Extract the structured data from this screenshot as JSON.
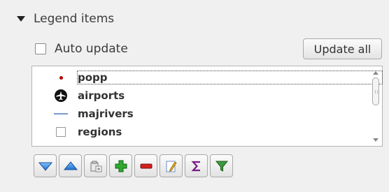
{
  "section": {
    "title": "Legend items",
    "icon": "triangle-down-icon"
  },
  "auto_update": {
    "label": "Auto update",
    "checked": false
  },
  "update_all_label": "Update all",
  "legend_items": [
    {
      "label": "popp",
      "icon": "point-symbol-icon",
      "selected": true
    },
    {
      "label": "airports",
      "icon": "airport-symbol-icon",
      "selected": false
    },
    {
      "label": "majrivers",
      "icon": "line-symbol-icon",
      "selected": false
    },
    {
      "label": "regions",
      "icon": "polygon-symbol-icon",
      "selected": false
    }
  ],
  "toolbar": [
    {
      "name": "move-down",
      "icon": "move-down-icon"
    },
    {
      "name": "move-up",
      "icon": "move-up-icon"
    },
    {
      "name": "add-group",
      "icon": "add-group-icon"
    },
    {
      "name": "add",
      "icon": "add-icon"
    },
    {
      "name": "remove",
      "icon": "remove-icon"
    },
    {
      "name": "edit",
      "icon": "edit-icon"
    },
    {
      "name": "count",
      "icon": "sigma-icon"
    },
    {
      "name": "filter",
      "icon": "filter-icon"
    }
  ],
  "colors": {
    "point": "#b40000",
    "line": "#7a9acc",
    "add": "#2fa82f",
    "remove": "#d22020",
    "sigma": "#7a1a8a",
    "filter": "#3c9a3c",
    "arrows": "#2a78d0"
  }
}
